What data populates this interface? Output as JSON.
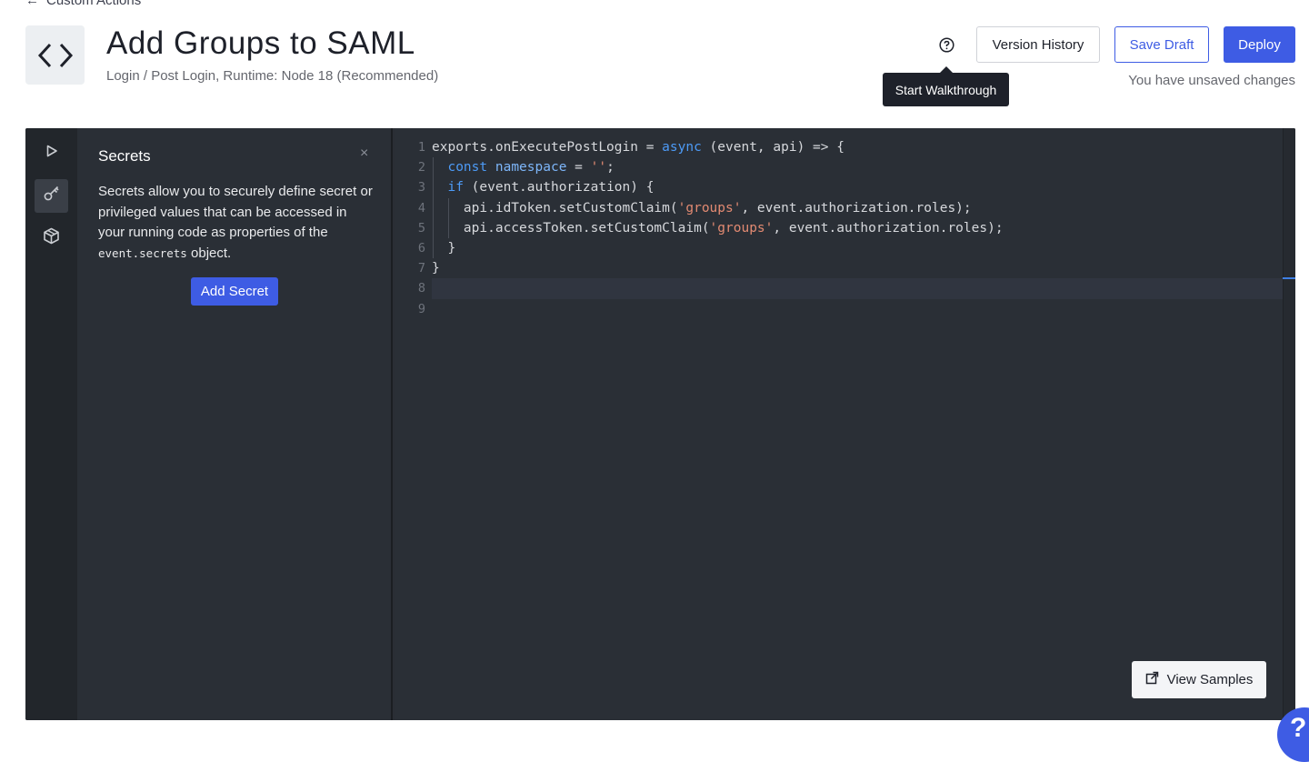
{
  "nav": {
    "back_label": "Custom Actions"
  },
  "header": {
    "title": "Add Groups to SAML",
    "subtitle": "Login / Post Login, Runtime: Node 18 (Recommended)",
    "tooltip": "Start Walkthrough",
    "version_history_label": "Version History",
    "save_draft_label": "Save Draft",
    "deploy_label": "Deploy",
    "unsaved_text": "You have unsaved changes"
  },
  "sidebar": {
    "icons": [
      "play-icon",
      "key-icon",
      "package-icon"
    ],
    "active_index": 1
  },
  "secrets_panel": {
    "title": "Secrets",
    "close_symbol": "×",
    "description_before": "Secrets allow you to securely define secret or privileged values that can be accessed in your running code as properties of the ",
    "description_code": "event.secrets",
    "description_after": " object.",
    "add_button_label": "Add Secret"
  },
  "editor": {
    "line_numbers": [
      "1",
      "2",
      "3",
      "4",
      "5",
      "6",
      "7",
      "8",
      "9"
    ],
    "current_line": 8,
    "code": {
      "l1_a": "exports.onExecutePostLogin = ",
      "l1_kw": "async",
      "l1_b": " (event, api) => {",
      "l2_kw": "const",
      "l2_var": "namespace",
      "l2_b": " = ",
      "l2_str": "''",
      "l2_c": ";",
      "l3_kw": "if",
      "l3_b": " (event.authorization) {",
      "l4_a": "api.idToken.setCustomClaim(",
      "l4_str": "'groups'",
      "l4_b": ", event.authorization.roles);",
      "l5_a": "api.accessToken.setCustomClaim(",
      "l5_str": "'groups'",
      "l5_b": ", event.authorization.roles);",
      "l6": "}",
      "l7": "}"
    },
    "view_samples_label": "View Samples"
  },
  "help_fab_label": "?",
  "colors": {
    "accent": "#3e5ce4",
    "editor_bg": "#2a2f36",
    "keyword": "#4d9bf7",
    "string": "#e28a72"
  }
}
